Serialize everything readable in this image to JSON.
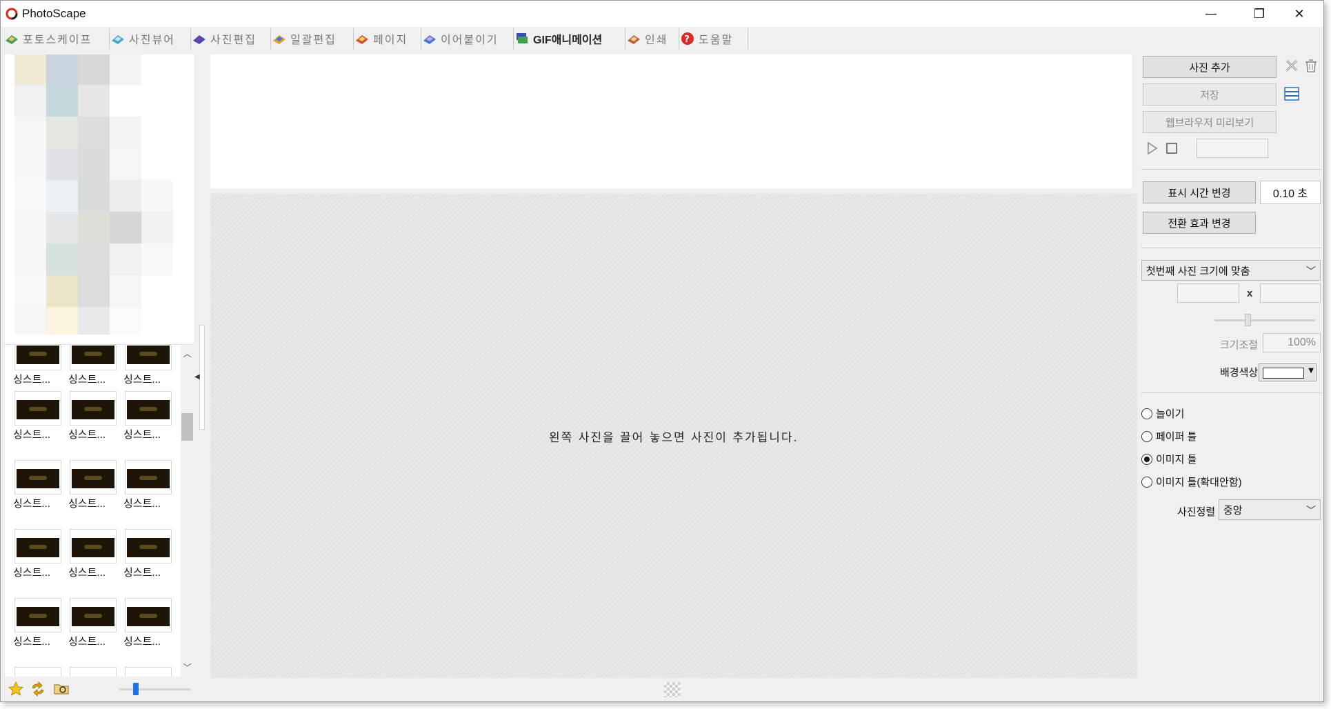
{
  "window": {
    "title": "PhotoScape",
    "controls": {
      "minimize": "—",
      "maximize": "❐",
      "close": "✕"
    }
  },
  "tabs": [
    {
      "label": "포토스케이프",
      "icon": "photoscape-tab-icon",
      "active": false
    },
    {
      "label": "사진뷰어",
      "icon": "viewer-tab-icon",
      "active": false
    },
    {
      "label": "사진편집",
      "icon": "editor-tab-icon",
      "active": false
    },
    {
      "label": "일괄편집",
      "icon": "batch-tab-icon",
      "active": false
    },
    {
      "label": "페이지",
      "icon": "page-tab-icon",
      "active": false
    },
    {
      "label": "이어붙이기",
      "icon": "combine-tab-icon",
      "active": false
    },
    {
      "label": "GIF애니메이션",
      "icon": "gif-tab-icon",
      "active": true
    },
    {
      "label": "인쇄",
      "icon": "print-tab-icon",
      "active": false
    },
    {
      "label": "도움말",
      "icon": "help-tab-icon",
      "active": false
    }
  ],
  "thumbnails": {
    "caption": "싱스트...",
    "rows": 5,
    "cols": 3
  },
  "left_bottom": {
    "icons": [
      "favorite-star-icon",
      "refresh-icon",
      "folder-icon"
    ],
    "zoom": 0.3
  },
  "canvas": {
    "hint": "왼쪽 사진을 끌어 놓으면 사진이 추가됩니다."
  },
  "right_panel": {
    "add_photo_button": "사진 추가",
    "save_button": "저장",
    "browser_preview_button": "웹브라우저 미리보기",
    "change_time_button": "표시 시간 변경",
    "time_value": "0.10 초",
    "change_effect_button": "전환 효과 변경",
    "size_mode": "첫번째 사진 크기에 맞춤",
    "size_x_label": "x",
    "resize_label": "크기조절",
    "resize_value": "100%",
    "bg_color_label": "배경색상",
    "bg_color": "#ffffff",
    "fit_options": [
      {
        "label": "늘이기",
        "selected": false
      },
      {
        "label": "페이퍼 틀",
        "selected": false
      },
      {
        "label": "이미지 틀",
        "selected": true
      },
      {
        "label": "이미지 틀(확대안함)",
        "selected": false
      }
    ],
    "align_label": "사진정렬",
    "align_value": "중앙"
  }
}
